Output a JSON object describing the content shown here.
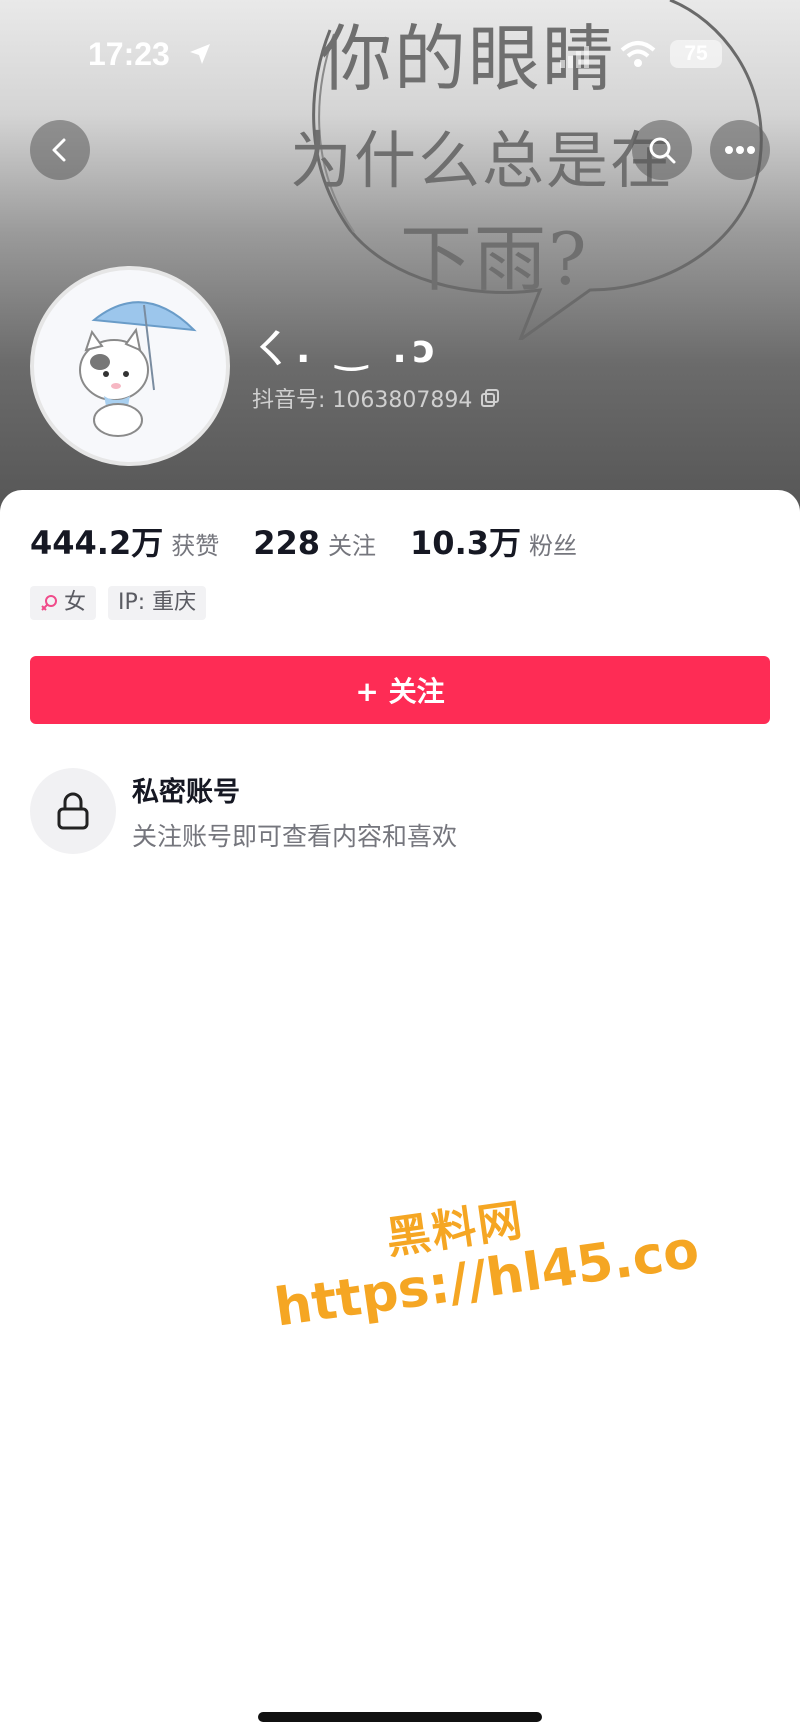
{
  "status_bar": {
    "time": "17:23",
    "battery": "75"
  },
  "header": {
    "doodle_lines": [
      "你的眼睛",
      "为什么总是在",
      "下雨?"
    ]
  },
  "profile": {
    "username": "ㄑ. ‿ .ɔ",
    "douyin_id": "抖音号: 1063807894"
  },
  "stats": [
    {
      "value": "444.2万",
      "label": "获赞"
    },
    {
      "value": "228",
      "label": "关注"
    },
    {
      "value": "10.3万",
      "label": "粉丝"
    }
  ],
  "tags": {
    "gender": "女",
    "ip": "IP: 重庆"
  },
  "follow_button": {
    "label": "+ 关注"
  },
  "private_notice": {
    "title": "私密账号",
    "subtitle": "关注账号即可查看内容和喜欢"
  },
  "watermark": {
    "title": "黑料网",
    "url": "https://hl45.co"
  },
  "colors": {
    "accent": "#fe2c55",
    "watermark": "#f5a623"
  }
}
